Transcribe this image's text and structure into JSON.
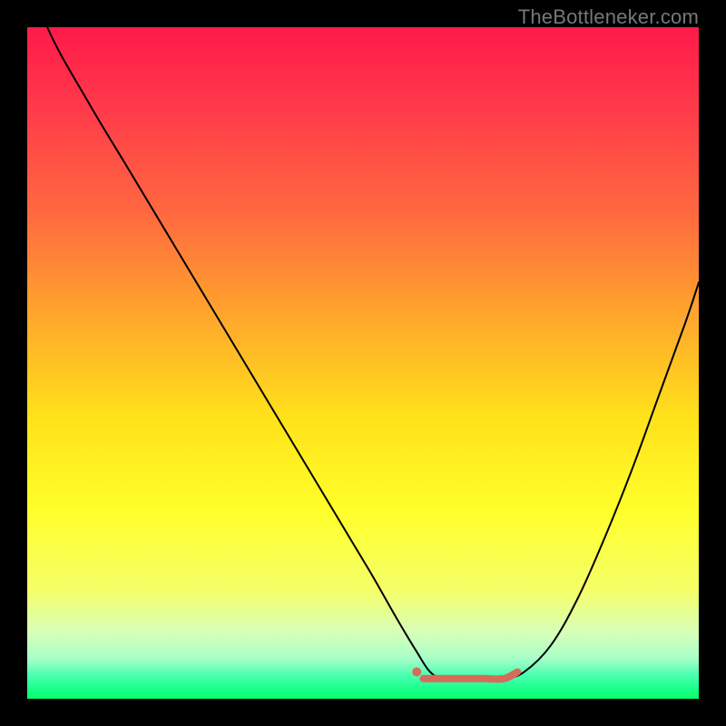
{
  "watermark": "TheBottleneker.com",
  "chart_data": {
    "type": "line",
    "title": "",
    "xlabel": "",
    "ylabel": "",
    "xlim": [
      0,
      100
    ],
    "ylim": [
      0,
      100
    ],
    "gradient_stops": [
      {
        "offset": 0.0,
        "color": "#ff1a4a"
      },
      {
        "offset": 0.12,
        "color": "#ff3a4a"
      },
      {
        "offset": 0.28,
        "color": "#ff6a3f"
      },
      {
        "offset": 0.45,
        "color": "#ffae2a"
      },
      {
        "offset": 0.58,
        "color": "#ffe11a"
      },
      {
        "offset": 0.72,
        "color": "#ffff2a"
      },
      {
        "offset": 0.84,
        "color": "#f4ff6a"
      },
      {
        "offset": 0.9,
        "color": "#d8ffb8"
      },
      {
        "offset": 0.94,
        "color": "#a8ffc8"
      },
      {
        "offset": 0.965,
        "color": "#4affb0"
      },
      {
        "offset": 0.985,
        "color": "#1aff8a"
      },
      {
        "offset": 1.0,
        "color": "#0aff6a"
      }
    ],
    "series": [
      {
        "name": "bottleneck-curve",
        "color": "#000000",
        "width": 2,
        "x": [
          0,
          3,
          9,
          15,
          21,
          27,
          33,
          39,
          45,
          51,
          55,
          58,
          60,
          62,
          65,
          68,
          71,
          74,
          78,
          82,
          86,
          90,
          94,
          98,
          100
        ],
        "y": [
          110,
          100,
          89,
          79,
          69,
          59,
          49,
          39,
          29,
          19,
          12,
          7,
          4,
          3,
          3,
          3,
          3,
          4,
          8,
          15,
          24,
          34,
          45,
          56,
          62
        ]
      },
      {
        "name": "highlight-flat",
        "color": "#d86a5a",
        "width": 8,
        "x": [
          59,
          62,
          65,
          68,
          71,
          73
        ],
        "y": [
          3,
          3,
          3,
          3,
          3,
          4
        ]
      }
    ],
    "highlight_dot": {
      "x": 58,
      "y": 4,
      "r": 5,
      "color": "#d86a5a"
    }
  }
}
